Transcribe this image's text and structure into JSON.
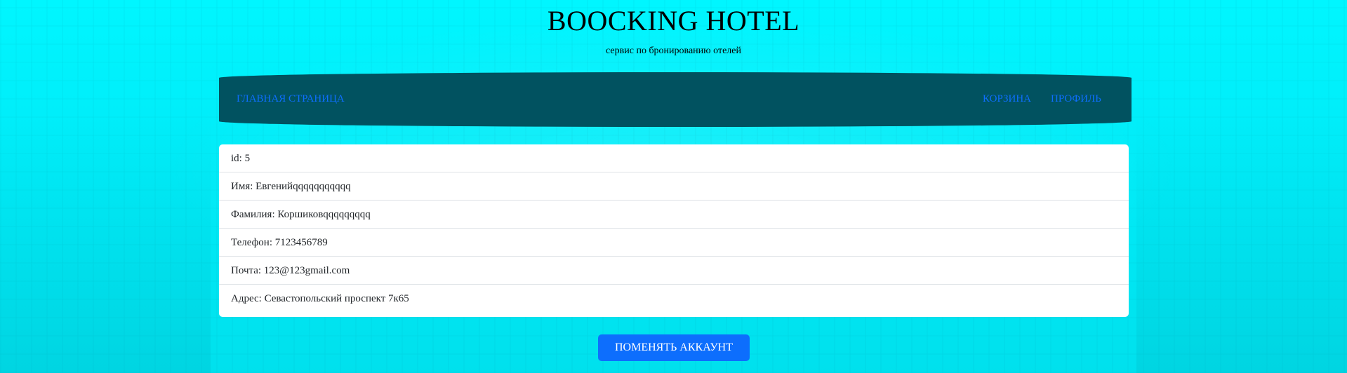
{
  "header": {
    "title": "BOOCKING HOTEL",
    "subtitle": "сервис по бронированию отелей"
  },
  "nav": {
    "home": "ГЛАВНАЯ СТРАНИЦА",
    "cart": "КОРЗИНА",
    "profile": "ПРОФИЛЬ"
  },
  "profile": {
    "id": "id: 5",
    "first_name": "Имя: Евгенийqqqqqqqqqqq",
    "last_name": "Фамилия: Коршиковqqqqqqqqq",
    "phone": "Телефон: 7123456789",
    "email": "Почта: 123@123gmail.com",
    "address": "Адрес: Севастопольский проспект 7к65"
  },
  "actions": {
    "change_account": "ПОМЕНЯТЬ АККАУНТ"
  },
  "colors": {
    "background": "#00f2fb",
    "navbar": "#015260",
    "link": "#0d6efd",
    "button": "#0d6efd"
  }
}
